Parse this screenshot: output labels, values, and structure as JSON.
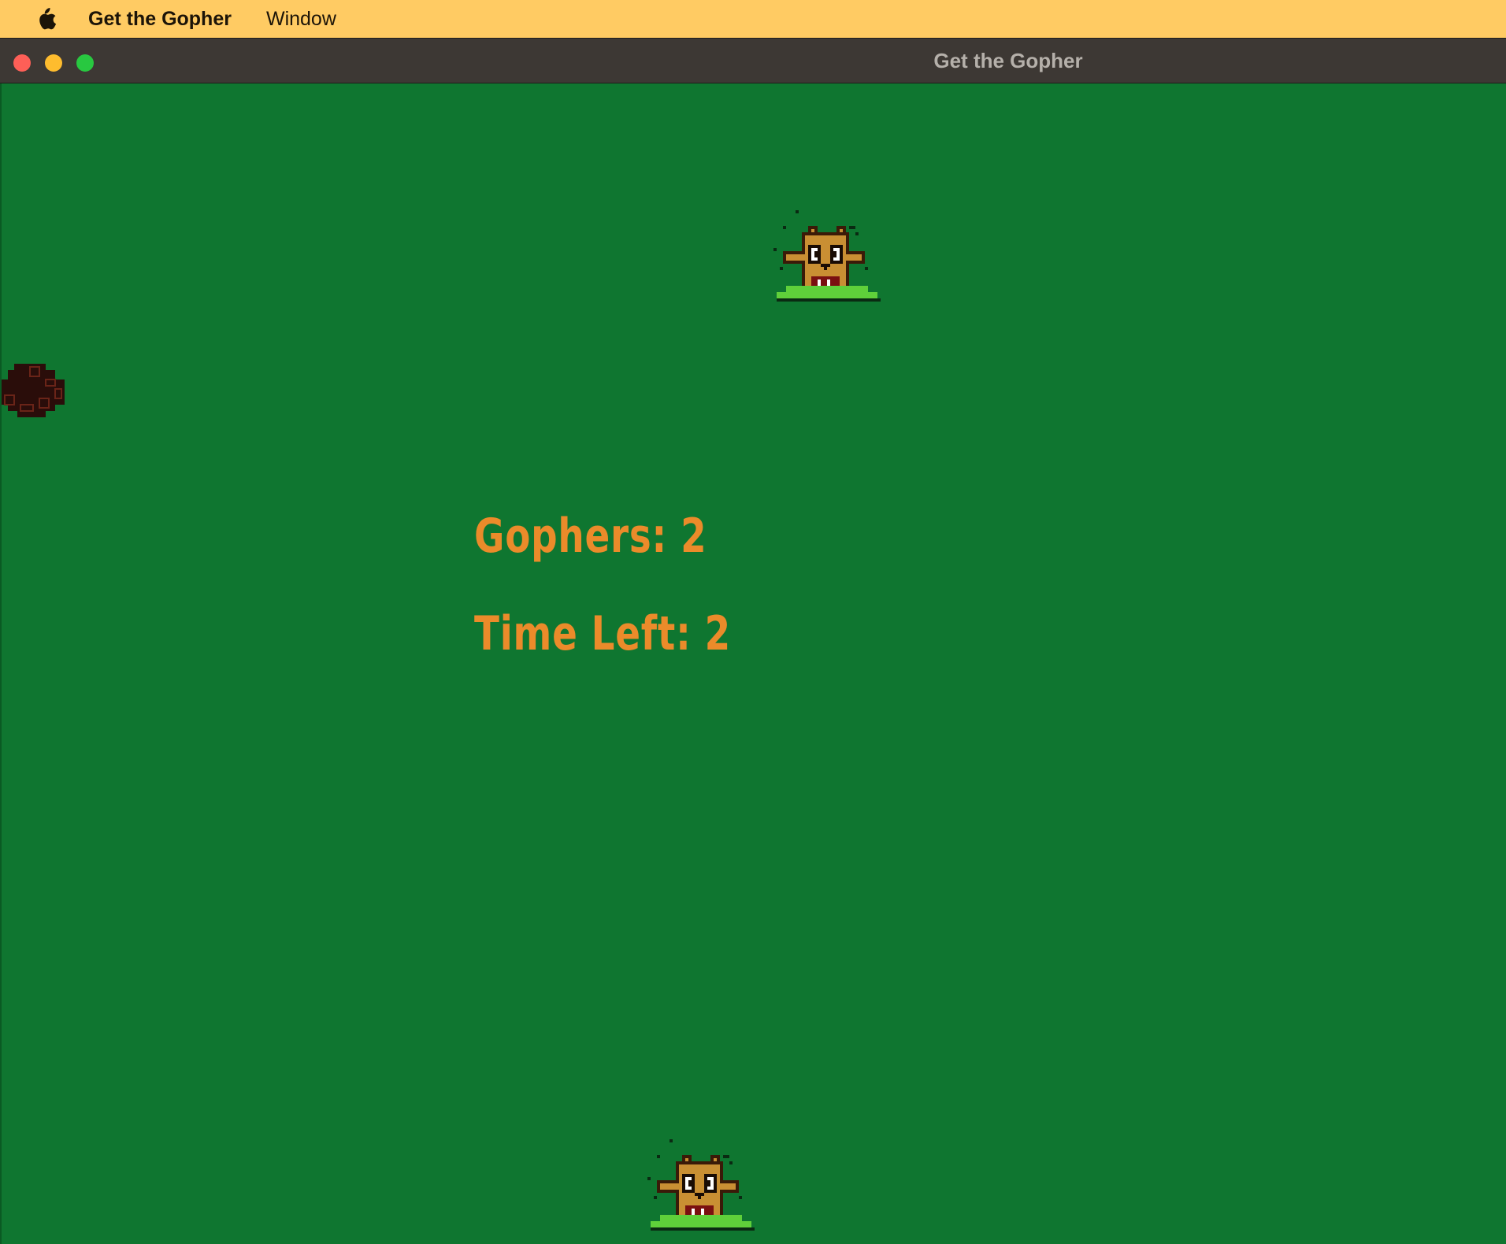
{
  "menubar": {
    "apple_icon": "apple-logo-icon",
    "app_name": "Get the Gopher",
    "items": [
      "Window"
    ]
  },
  "window": {
    "title": "Get the Gopher",
    "controls": [
      "close",
      "minimize",
      "zoom"
    ]
  },
  "game": {
    "gophers_label": "Gophers:",
    "gophers_count": "2",
    "time_left_label": "Time Left:",
    "time_left_value": "2",
    "colors": {
      "field": "#0f7630",
      "hud_text": "#eb8b2a",
      "gopher_body": "#c98f33",
      "dirt_mound": "#2a0d0a"
    },
    "sprites": [
      "gopher-icon",
      "gopher-icon",
      "dirt-hole-icon"
    ]
  }
}
